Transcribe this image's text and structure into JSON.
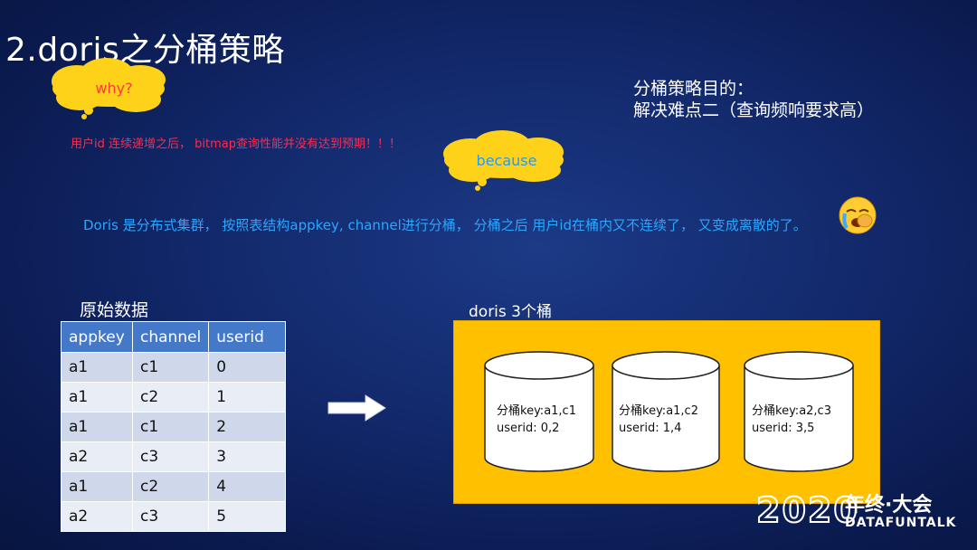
{
  "slide": {
    "title": "2.doris之分桶策略",
    "cloud_why": "why?",
    "cloud_because": "because",
    "problem_text": "用户id 连续递增之后， bitmap查询性能并没有达到预期！！！",
    "purpose_line1": "分桶策略目的：",
    "purpose_line2": "解决难点二（查询频响要求高）",
    "explanation": "Doris 是分布式集群， 按照表结构appkey, channel进行分桶， 分桶之后 用户id在桶内又不连续了， 又变成离散的了。",
    "emoji_icon": "crying-face-icon"
  },
  "raw_table": {
    "label": "原始数据",
    "headers": [
      "appkey",
      "channel",
      "userid"
    ],
    "rows": [
      [
        "a1",
        "c1",
        "0"
      ],
      [
        "a1",
        "c2",
        "1"
      ],
      [
        "a1",
        "c1",
        "2"
      ],
      [
        "a2",
        "c3",
        "3"
      ],
      [
        "a1",
        "c2",
        "4"
      ],
      [
        "a2",
        "c3",
        "5"
      ]
    ],
    "colors": {
      "header": "#4478c8",
      "row": "#cfd8ea",
      "row_alt": "#e8edf6"
    }
  },
  "buckets": {
    "label": "doris  3个桶",
    "items": [
      {
        "key": "分桶key:a1,c1",
        "userid": "userid:  0,2"
      },
      {
        "key": "分桶key:a1,c2",
        "userid": "userid:  1,4"
      },
      {
        "key": "分桶key:a2,c3",
        "userid": "userid:  3,5"
      }
    ],
    "box_color": "#ffc000"
  },
  "watermark": {
    "year": "2020",
    "cn": "年终·大会",
    "en": "DATAFUNTALK"
  }
}
